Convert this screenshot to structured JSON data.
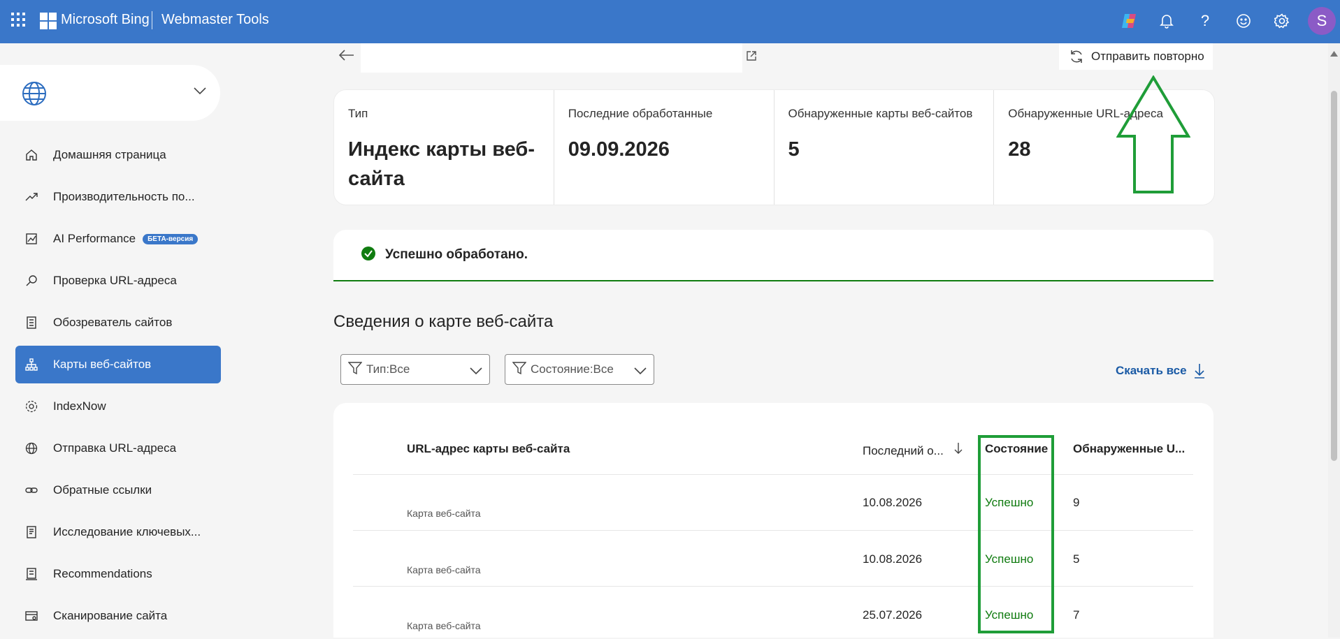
{
  "topbar": {
    "brand": "Microsoft Bing",
    "product": "Webmaster Tools",
    "avatar_initial": "S",
    "color": "#3a77c9"
  },
  "sidebar": {
    "items": [
      {
        "label": "Домашняя страница",
        "icon": "home-icon"
      },
      {
        "label": "Производительность по...",
        "icon": "trend-icon"
      },
      {
        "label": "AI Performance",
        "icon": "chart-icon",
        "badge": "БЕТА-версия"
      },
      {
        "label": "Проверка URL-адреса",
        "icon": "search-icon"
      },
      {
        "label": "Обозреватель сайтов",
        "icon": "list-icon"
      },
      {
        "label": "Карты веб-сайтов",
        "icon": "sitemap-icon",
        "active": true
      },
      {
        "label": "IndexNow",
        "icon": "gear-icon"
      },
      {
        "label": "Отправка URL-адреса",
        "icon": "globe-icon"
      },
      {
        "label": "Обратные ссылки",
        "icon": "link-icon"
      },
      {
        "label": "Исследование ключевых...",
        "icon": "document-icon"
      },
      {
        "label": "Recommendations",
        "icon": "checklist-icon"
      },
      {
        "label": "Сканирование сайта",
        "icon": "scan-icon"
      }
    ]
  },
  "header": {
    "resubmit_label": "Отправить повторно"
  },
  "info": {
    "type_label": "Тип",
    "type_value": "Индекс карты веб-сайта",
    "last_processed_label": "Последние обработанные",
    "last_processed_value": "09.09.2026",
    "sitemaps_label": "Обнаруженные карты веб-сайтов",
    "sitemaps_value": "5",
    "urls_label": "Обнаруженные URL-адреса",
    "urls_value": "28"
  },
  "status": {
    "text": "Успешно обработано.",
    "color": "#107c10"
  },
  "details": {
    "title": "Сведения о карте веб-сайта",
    "filter_type": "Тип:Все",
    "filter_status": "Состояние:Все",
    "download_label": "Скачать все"
  },
  "table": {
    "headers": {
      "url": "URL-адрес карты веб-сайта",
      "last": "Последний о...",
      "status": "Состояние",
      "discovered": "Обнаруженные U..."
    },
    "rows": [
      {
        "type": "Карта веб-сайта",
        "date": "10.08.2026",
        "status": "Успешно",
        "count": "9"
      },
      {
        "type": "Карта веб-сайта",
        "date": "10.08.2026",
        "status": "Успешно",
        "count": "5"
      },
      {
        "type": "Карта веб-сайта",
        "date": "25.07.2026",
        "status": "Успешно",
        "count": "7"
      }
    ]
  },
  "annotation_color": "#1f9d38"
}
